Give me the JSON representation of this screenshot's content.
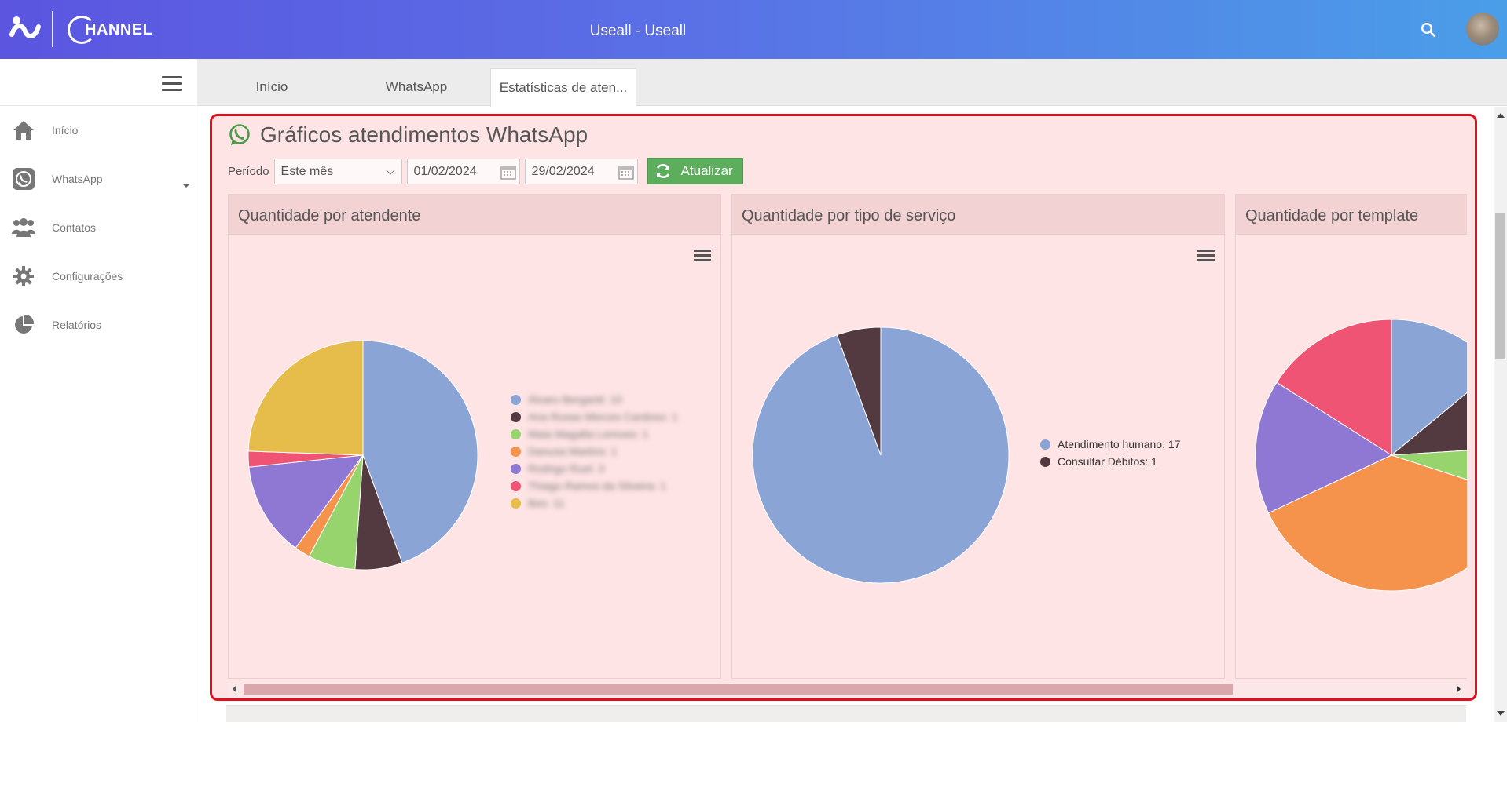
{
  "header": {
    "title": "Useall - Useall",
    "brand": "HANNEL"
  },
  "sidebar": {
    "items": [
      {
        "label": "Início",
        "icon": "home-icon"
      },
      {
        "label": "WhatsApp",
        "icon": "whatsapp-icon"
      },
      {
        "label": "Contatos",
        "icon": "contacts-icon"
      },
      {
        "label": "Configurações",
        "icon": "gear-icon"
      },
      {
        "label": "Relatórios",
        "icon": "pie-chart-icon"
      }
    ]
  },
  "tabs": [
    {
      "label": "Início",
      "active": false
    },
    {
      "label": "WhatsApp",
      "active": false
    },
    {
      "label": "Estatísticas de aten...",
      "active": true
    }
  ],
  "panel": {
    "title": "Gráficos atendimentos WhatsApp",
    "period_label": "Período",
    "period_value": "Este mês",
    "date_from": "01/02/2024",
    "date_to": "29/02/2024",
    "refresh_label": "Atualizar"
  },
  "colors": {
    "accent": "#e0101e",
    "refresh": "#5cae5c",
    "pie": [
      "#8aa4d6",
      "#533a40",
      "#98d46e",
      "#f5934d",
      "#8e78d3",
      "#ef5474",
      "#e6bc4a"
    ]
  },
  "chart_data": [
    {
      "type": "pie",
      "title": "Quantidade por atendente",
      "legend": "right",
      "legend_text_obscured": true,
      "slices": [
        {
          "label": "Álvaro Bergantt: 10",
          "value": 10,
          "color": "#8aa4d6"
        },
        {
          "label": "Ana Rosas Merces Cardoso: 1",
          "value": 1.5,
          "color": "#533a40"
        },
        {
          "label": "Maia Magalta Lemoes: 1",
          "value": 1.5,
          "color": "#98d46e"
        },
        {
          "label": "Danusa Martins: 1",
          "value": 0.5,
          "color": "#f5934d"
        },
        {
          "label": "Rodrigo Ruel: 3",
          "value": 3,
          "color": "#8e78d3"
        },
        {
          "label": "Thiago Ramos da Silveira: 1",
          "value": 0.5,
          "color": "#ef5474"
        },
        {
          "label": "Bes: 11",
          "value": 5.5,
          "color": "#e6bc4a"
        }
      ]
    },
    {
      "type": "pie",
      "title": "Quantidade por tipo de serviço",
      "legend": "right",
      "slices": [
        {
          "label": "Atendimento humano: 17",
          "value": 17,
          "color": "#8aa4d6"
        },
        {
          "label": "Consultar Débitos: 1",
          "value": 1,
          "color": "#533a40"
        }
      ]
    },
    {
      "type": "pie",
      "title": "Quantidade por template",
      "legend": "right",
      "partially_visible": true,
      "slices": [
        {
          "label": "",
          "value": 14,
          "color": "#8aa4d6"
        },
        {
          "label": "",
          "value": 10,
          "color": "#533a40"
        },
        {
          "label": "",
          "value": 6,
          "color": "#98d46e"
        },
        {
          "label": "",
          "value": 38,
          "color": "#f5934d"
        },
        {
          "label": "",
          "value": 16,
          "color": "#8e78d3"
        },
        {
          "label": "",
          "value": 16,
          "color": "#ef5474"
        }
      ]
    }
  ]
}
